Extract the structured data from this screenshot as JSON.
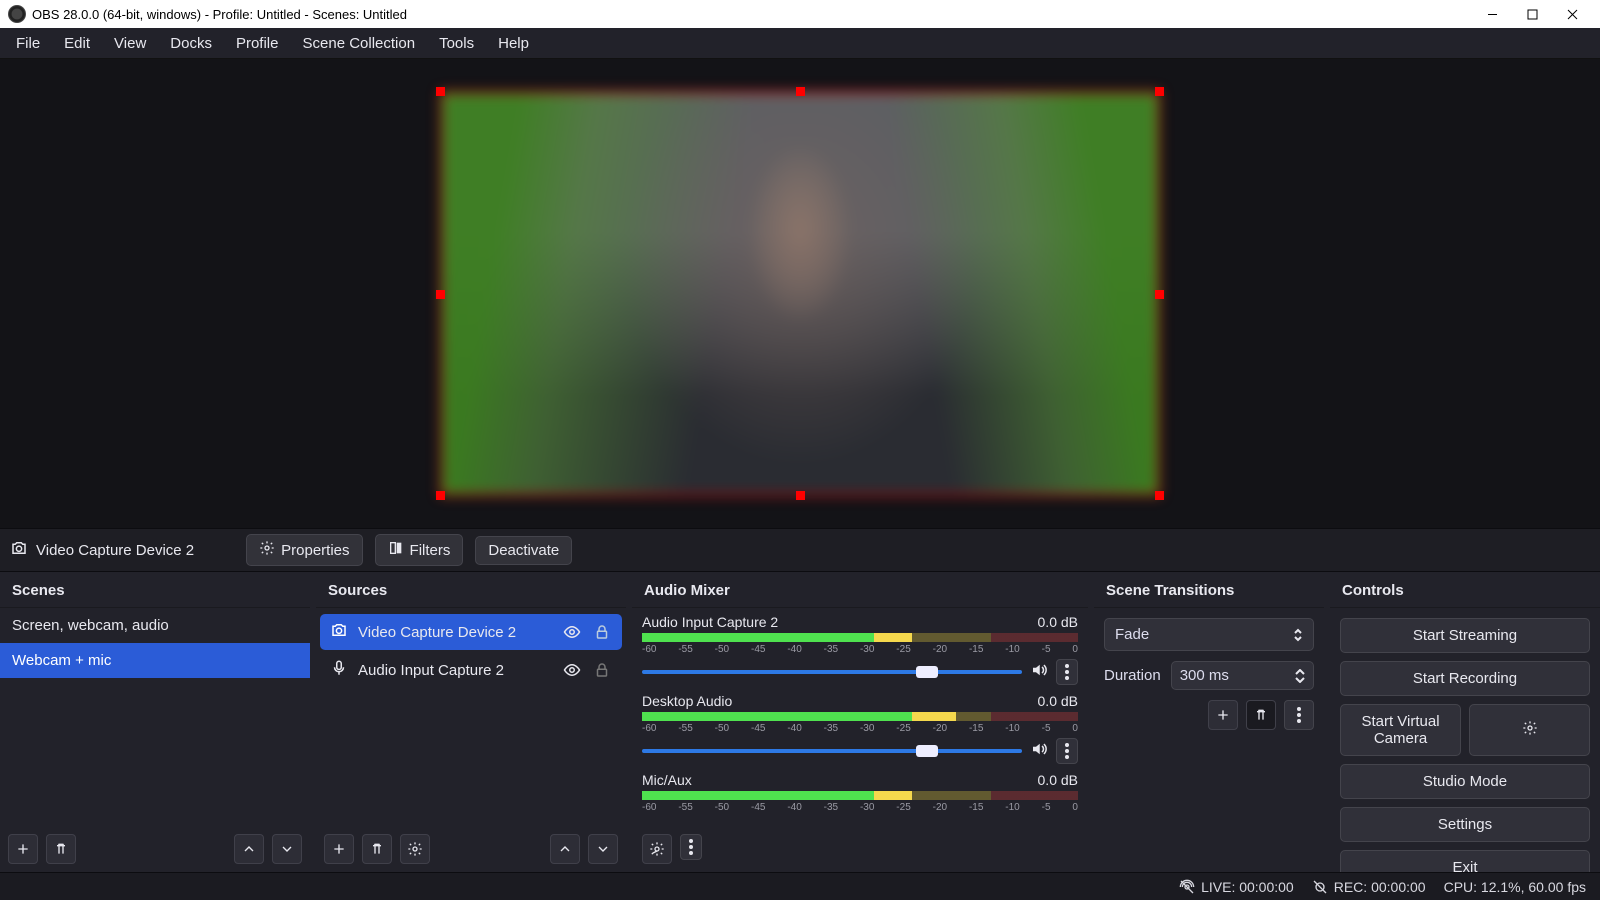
{
  "title": "OBS 28.0.0 (64-bit, windows) - Profile: Untitled - Scenes: Untitled",
  "menubar": [
    "File",
    "Edit",
    "View",
    "Docks",
    "Profile",
    "Scene Collection",
    "Tools",
    "Help"
  ],
  "context_toolbar": {
    "source_label": "Video Capture Device 2",
    "properties": "Properties",
    "filters": "Filters",
    "deactivate": "Deactivate"
  },
  "scenes": {
    "header": "Scenes",
    "items": [
      {
        "label": "Screen, webcam, audio",
        "selected": false
      },
      {
        "label": "Webcam + mic",
        "selected": true
      }
    ]
  },
  "sources": {
    "header": "Sources",
    "items": [
      {
        "label": "Video Capture Device 2",
        "icon": "camera",
        "selected": true
      },
      {
        "label": "Audio Input Capture 2",
        "icon": "mic",
        "selected": false
      }
    ]
  },
  "mixer": {
    "header": "Audio Mixer",
    "scale": [
      "-60",
      "-55",
      "-50",
      "-45",
      "-40",
      "-35",
      "-30",
      "-25",
      "-20",
      "-15",
      "-10",
      "-5",
      "0"
    ],
    "channels": [
      {
        "name": "Audio Input Capture 2",
        "db": "0.0 dB",
        "fill": 62,
        "thumb": 72,
        "show_slider": true
      },
      {
        "name": "Desktop Audio",
        "db": "0.0 dB",
        "fill": 72,
        "thumb": 72,
        "show_slider": true
      },
      {
        "name": "Mic/Aux",
        "db": "0.0 dB",
        "fill": 62,
        "thumb": 72,
        "show_slider": false
      }
    ]
  },
  "transitions": {
    "header": "Scene Transitions",
    "selected": "Fade",
    "duration_label": "Duration",
    "duration_value": "300 ms"
  },
  "controls": {
    "header": "Controls",
    "start_streaming": "Start Streaming",
    "start_recording": "Start Recording",
    "start_virtual_camera": "Start Virtual Camera",
    "studio_mode": "Studio Mode",
    "settings": "Settings",
    "exit": "Exit"
  },
  "statusbar": {
    "live": "LIVE: 00:00:00",
    "rec": "REC: 00:00:00",
    "cpu": "CPU: 12.1%, 60.00 fps"
  }
}
